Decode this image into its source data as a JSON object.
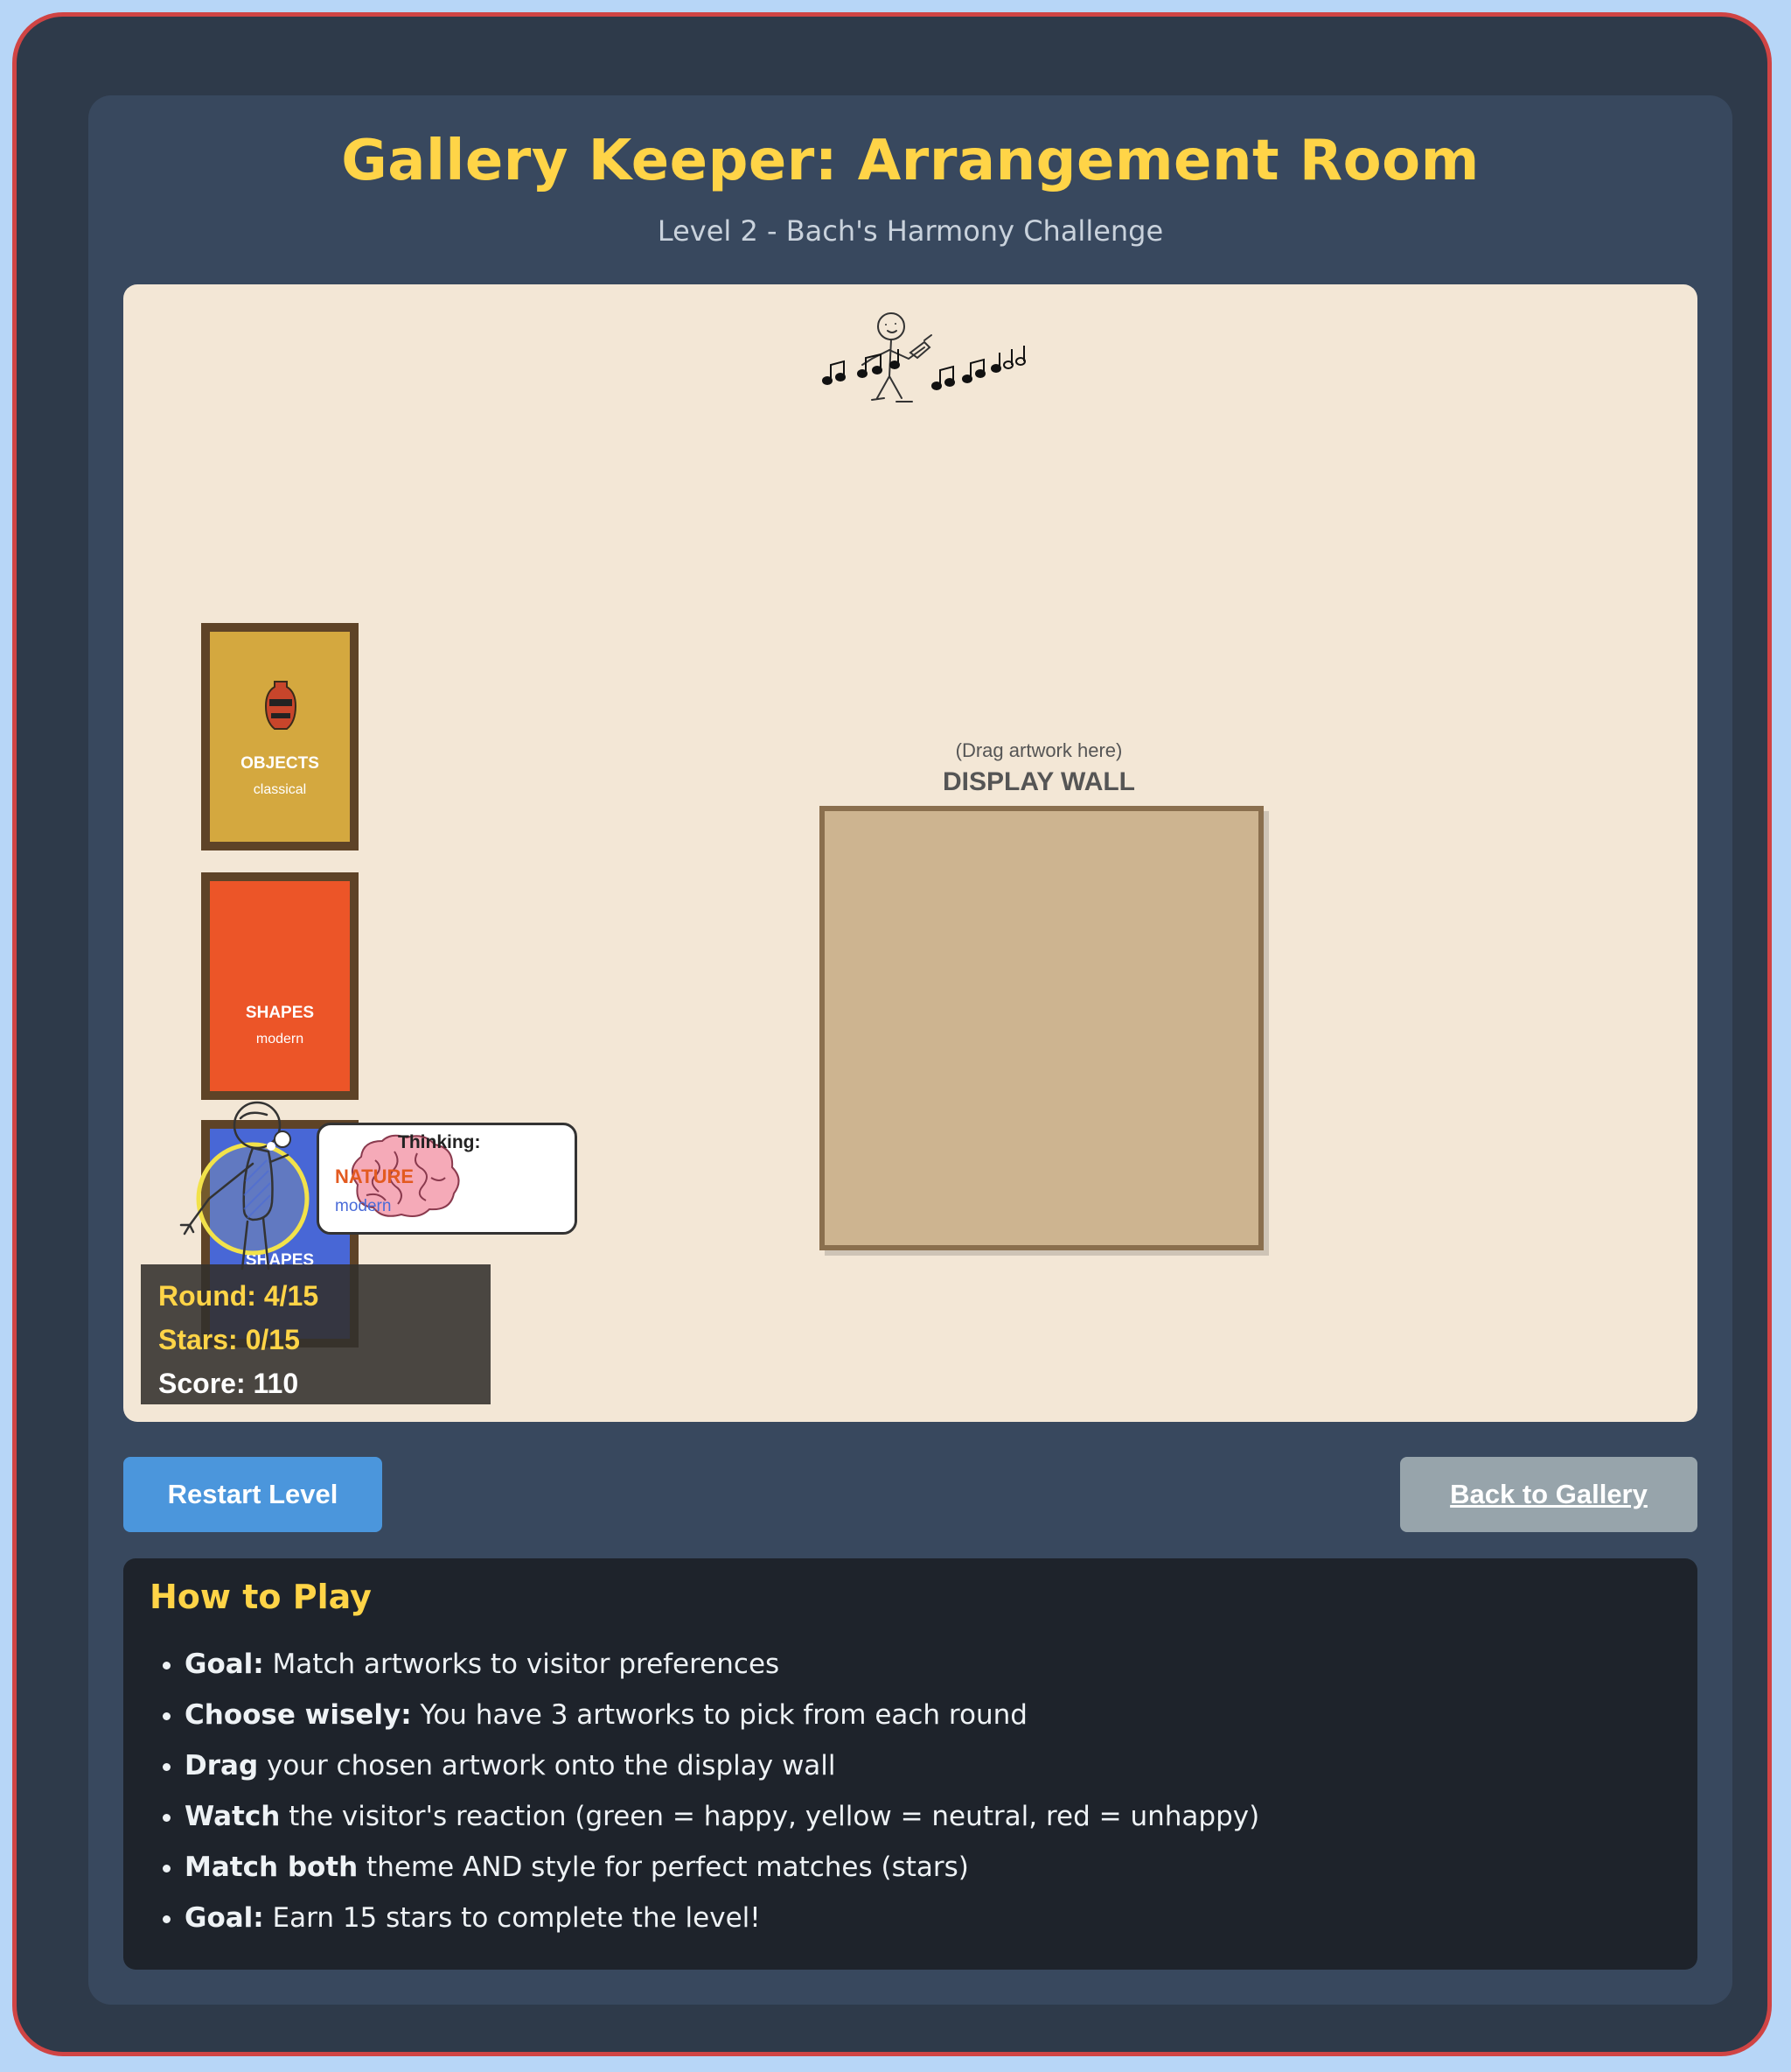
{
  "header": {
    "title": "Gallery Keeper: Arrangement Room",
    "subtitle": "Level 2 - Bach's Harmony Challenge"
  },
  "artworks": [
    {
      "theme": "OBJECTS",
      "style": "classical",
      "color": "#d4a83f",
      "icon": "vase-icon"
    },
    {
      "theme": "SHAPES",
      "style": "modern",
      "color": "#ec5528",
      "icon": ""
    },
    {
      "theme": "SHAPES",
      "style": "",
      "color": "#4867d6",
      "icon": ""
    }
  ],
  "wall": {
    "hint": "(Drag artwork here)",
    "title": "DISPLAY WALL"
  },
  "visitor": {
    "thinking_label": "Thinking:",
    "pref_theme": "NATURE",
    "pref_style": "modern",
    "mood_ring_color": "#f2e24a",
    "icon": "brain-icon"
  },
  "stats": {
    "round": "Round: 4/15",
    "stars": "Stars: 0/15",
    "score": "Score: 110"
  },
  "buttons": {
    "restart": "Restart Level",
    "back": "Back to Gallery"
  },
  "howto": {
    "title": "How to Play",
    "items": [
      {
        "bold": "Goal:",
        "text": " Match artworks to visitor preferences"
      },
      {
        "bold": "Choose wisely:",
        "text": " You have 3 artworks to pick from each round"
      },
      {
        "bold": "Drag",
        "text": " your chosen artwork onto the display wall"
      },
      {
        "bold": "Watch",
        "text": " the visitor's reaction (green = happy, yellow = neutral, red = unhappy)"
      },
      {
        "bold": "Match both",
        "text": " theme AND style for perfect matches (stars)"
      },
      {
        "bold": "Goal:",
        "text": " Earn 15 stars to complete the level!"
      }
    ]
  },
  "colors": {
    "accent": "#ffd447",
    "frame_border": "#d04444",
    "stage_bg": "#f3e7d6",
    "restart_btn": "#4b96dc",
    "back_btn": "#97a4ab"
  }
}
